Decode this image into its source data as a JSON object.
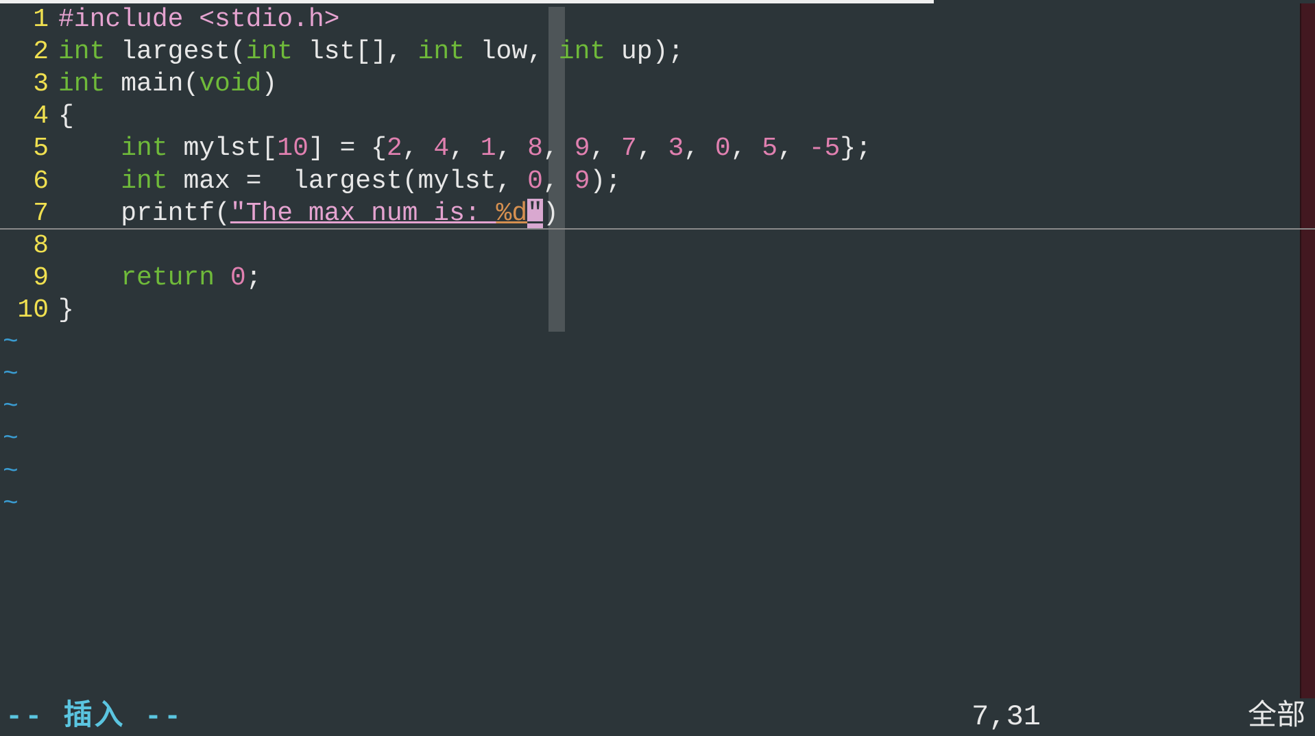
{
  "status": {
    "mode": "-- 插入 --",
    "cursor_position": "7,31",
    "file_position": "全部"
  },
  "lines": [
    {
      "num": "1",
      "tokens": [
        {
          "cls": "preproc",
          "text": "#include <stdio.h>"
        }
      ]
    },
    {
      "num": "2",
      "tokens": [
        {
          "cls": "type",
          "text": "int"
        },
        {
          "cls": "plain",
          "text": " largest("
        },
        {
          "cls": "type",
          "text": "int"
        },
        {
          "cls": "plain",
          "text": " lst[], "
        },
        {
          "cls": "type",
          "text": "int"
        },
        {
          "cls": "plain",
          "text": " low, "
        },
        {
          "cls": "type",
          "text": "int"
        },
        {
          "cls": "plain",
          "text": " up);"
        }
      ]
    },
    {
      "num": "3",
      "tokens": [
        {
          "cls": "type",
          "text": "int"
        },
        {
          "cls": "plain",
          "text": " main("
        },
        {
          "cls": "type",
          "text": "void"
        },
        {
          "cls": "plain",
          "text": ")"
        }
      ]
    },
    {
      "num": "4",
      "tokens": [
        {
          "cls": "plain",
          "text": "{"
        }
      ]
    },
    {
      "num": "5",
      "tokens": [
        {
          "cls": "plain",
          "text": "    "
        },
        {
          "cls": "type",
          "text": "int"
        },
        {
          "cls": "plain",
          "text": " mylst["
        },
        {
          "cls": "number",
          "text": "10"
        },
        {
          "cls": "plain",
          "text": "] = {"
        },
        {
          "cls": "number",
          "text": "2"
        },
        {
          "cls": "plain",
          "text": ", "
        },
        {
          "cls": "number",
          "text": "4"
        },
        {
          "cls": "plain",
          "text": ", "
        },
        {
          "cls": "number",
          "text": "1"
        },
        {
          "cls": "plain",
          "text": ", "
        },
        {
          "cls": "number",
          "text": "8"
        },
        {
          "cls": "plain",
          "text": ", "
        },
        {
          "cls": "number",
          "text": "9"
        },
        {
          "cls": "plain",
          "text": ", "
        },
        {
          "cls": "number",
          "text": "7"
        },
        {
          "cls": "plain",
          "text": ", "
        },
        {
          "cls": "number",
          "text": "3"
        },
        {
          "cls": "plain",
          "text": ", "
        },
        {
          "cls": "number",
          "text": "0"
        },
        {
          "cls": "plain",
          "text": ", "
        },
        {
          "cls": "number",
          "text": "5"
        },
        {
          "cls": "plain",
          "text": ", "
        },
        {
          "cls": "number",
          "text": "-5"
        },
        {
          "cls": "plain",
          "text": "};"
        }
      ]
    },
    {
      "num": "6",
      "tokens": [
        {
          "cls": "plain",
          "text": "    "
        },
        {
          "cls": "type",
          "text": "int"
        },
        {
          "cls": "plain",
          "text": " max =  largest(mylst, "
        },
        {
          "cls": "number",
          "text": "0"
        },
        {
          "cls": "plain",
          "text": ", "
        },
        {
          "cls": "number",
          "text": "9"
        },
        {
          "cls": "plain",
          "text": ");"
        }
      ]
    },
    {
      "num": "7",
      "current": true,
      "tokens": [
        {
          "cls": "plain",
          "text": "    printf("
        },
        {
          "cls": "string",
          "text": "\"The max num is: "
        },
        {
          "cls": "format",
          "text": "%d"
        },
        {
          "cls": "cursor-str",
          "text": "\""
        },
        {
          "cls": "plain",
          "text": ")"
        }
      ]
    },
    {
      "num": "8",
      "tokens": []
    },
    {
      "num": "9",
      "tokens": [
        {
          "cls": "plain",
          "text": "    "
        },
        {
          "cls": "keyword",
          "text": "return"
        },
        {
          "cls": "plain",
          "text": " "
        },
        {
          "cls": "number",
          "text": "0"
        },
        {
          "cls": "plain",
          "text": ";"
        }
      ]
    },
    {
      "num": "10",
      "tokens": [
        {
          "cls": "plain",
          "text": "}"
        }
      ]
    }
  ],
  "empty_lines_count": 6,
  "empty_line_char": "~"
}
